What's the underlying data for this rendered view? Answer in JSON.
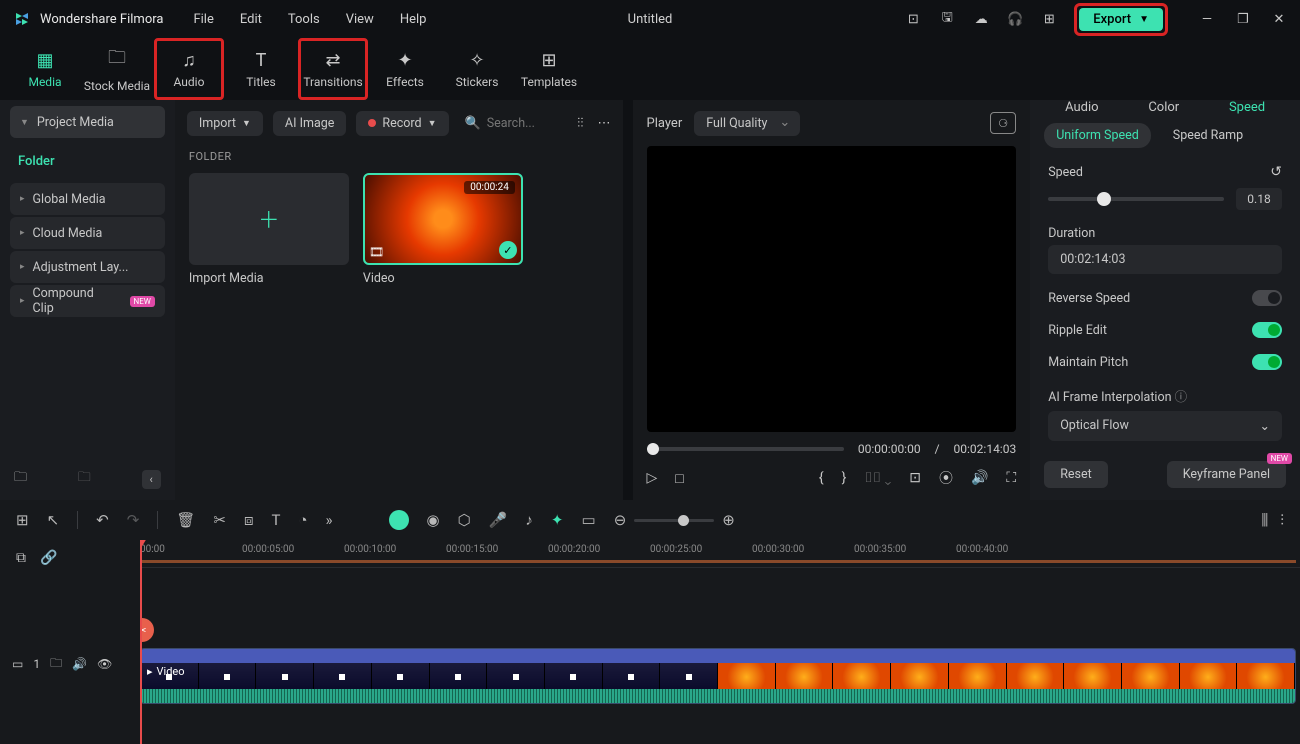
{
  "app": {
    "name": "Wondershare Filmora",
    "menus": [
      "File",
      "Edit",
      "Tools",
      "View",
      "Help"
    ],
    "doc": "Untitled",
    "export": "Export"
  },
  "tabs": {
    "media": "Media",
    "stock": "Stock Media",
    "audio": "Audio",
    "titles": "Titles",
    "transitions": "Transitions",
    "effects": "Effects",
    "stickers": "Stickers",
    "templates": "Templates"
  },
  "sidebar": {
    "project": "Project Media",
    "folder": "Folder",
    "items": [
      "Global Media",
      "Cloud Media",
      "Adjustment Lay...",
      "Compound Clip"
    ]
  },
  "midbar": {
    "import": "Import",
    "ai": "AI Image",
    "record": "Record",
    "search": "Search..."
  },
  "mediaPanel": {
    "folderHdr": "FOLDER",
    "importLbl": "Import Media",
    "videoLbl": "Video",
    "duration": "00:00:24"
  },
  "preview": {
    "player": "Player",
    "quality": "Full Quality",
    "cur": "00:00:00:00",
    "total": "00:02:14:03",
    "sep": "/"
  },
  "right": {
    "tabs": [
      "Audio",
      "Color",
      "Speed"
    ],
    "sub": [
      "Uniform Speed",
      "Speed Ramp"
    ],
    "speedLbl": "Speed",
    "speedVal": "0.18",
    "durLbl": "Duration",
    "durVal": "00:02:14:03",
    "reverse": "Reverse Speed",
    "ripple": "Ripple Edit",
    "pitch": "Maintain Pitch",
    "aiLbl": "AI Frame Interpolation",
    "aiVal": "Optical Flow",
    "reset": "Reset",
    "keyframe": "Keyframe Panel",
    "new": "NEW"
  },
  "ruler": [
    "00:00",
    "00:00:05:00",
    "00:00:10:00",
    "00:00:15:00",
    "00:00:20:00",
    "00:00:25:00",
    "00:00:30:00",
    "00:00:35:00",
    "00:00:40:00"
  ],
  "track": {
    "clipLabel": "Video",
    "count": "1"
  }
}
